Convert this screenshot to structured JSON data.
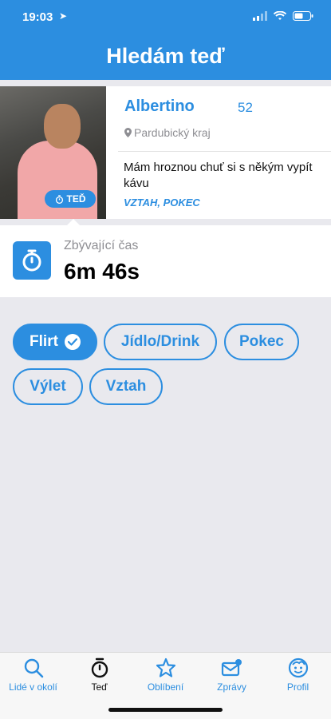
{
  "status_bar": {
    "time": "19:03"
  },
  "header": {
    "title": "Hledám teď"
  },
  "profile": {
    "name": "Albertino",
    "age": "52",
    "location": "Pardubický kraj",
    "description": "Mám hroznou chuť si s někým vypít kávu",
    "interests": "VZTAH, POKEC",
    "badge": "TEĎ"
  },
  "timer": {
    "label": "Zbývající čas",
    "value": "6m 46s"
  },
  "chips": [
    {
      "label": "Flirt",
      "selected": true
    },
    {
      "label": "Jídlo/Drink",
      "selected": false
    },
    {
      "label": "Pokec",
      "selected": false
    },
    {
      "label": "Výlet",
      "selected": false
    },
    {
      "label": "Vztah",
      "selected": false
    }
  ],
  "tabbar": {
    "items": [
      {
        "label": "Lidé v okolí",
        "icon": "search-icon"
      },
      {
        "label": "Teď",
        "icon": "stopwatch-icon",
        "active": true
      },
      {
        "label": "Oblíbení",
        "icon": "star-icon"
      },
      {
        "label": "Zprávy",
        "icon": "mail-icon"
      },
      {
        "label": "Profil",
        "icon": "face-icon"
      }
    ]
  },
  "colors": {
    "accent": "#2c8ee0",
    "background": "#e9e9ee"
  }
}
